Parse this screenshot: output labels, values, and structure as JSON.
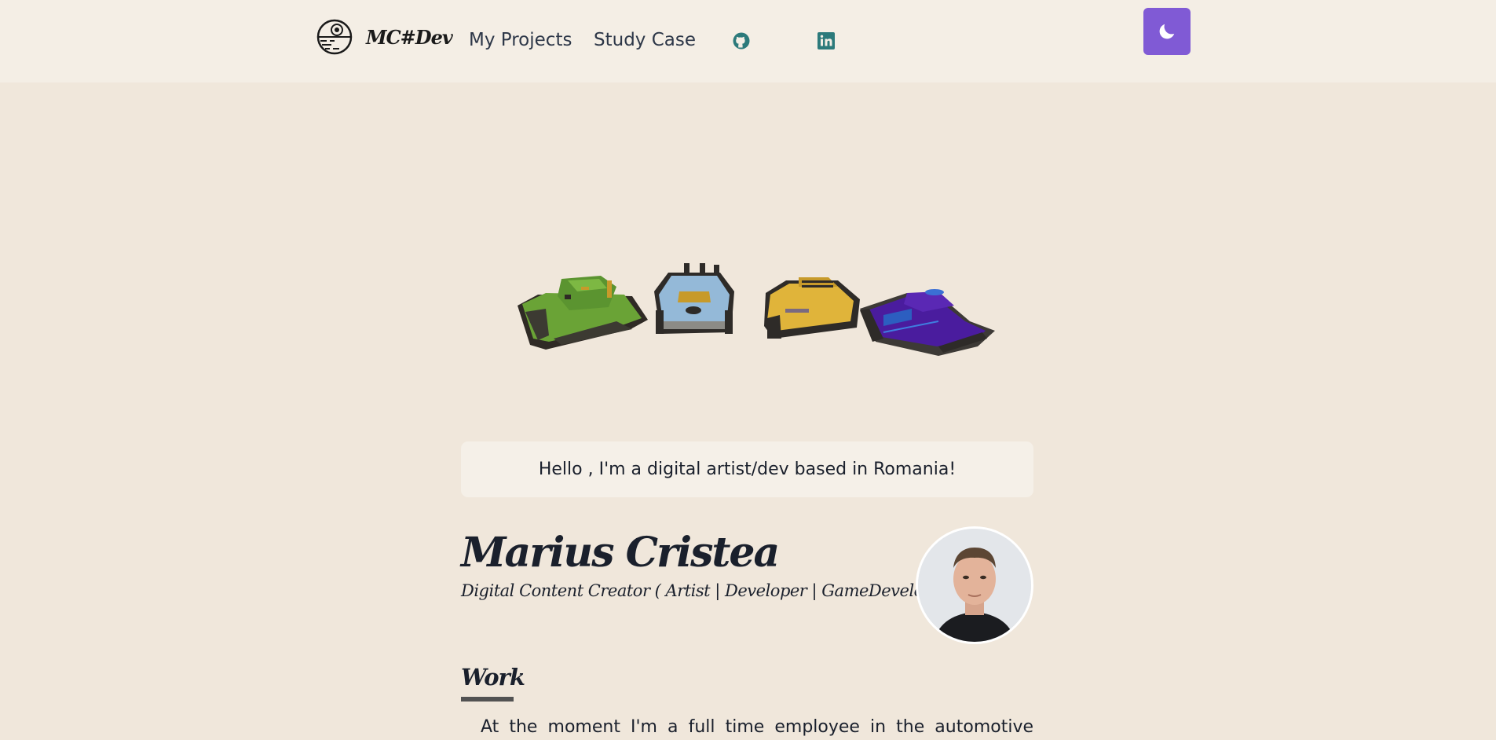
{
  "navbar": {
    "logo_text": "MC#Dev",
    "logo_icon": "death-star-icon",
    "links": [
      {
        "label": "My Projects"
      },
      {
        "label": "Study Case"
      }
    ],
    "github_icon": "github-icon",
    "linkedin_icon": "linkedin-icon",
    "theme_toggle_icon": "moon-icon",
    "colors": {
      "accent": "#805ad5",
      "icon": "#2c7a7b",
      "background": "#f4eee5"
    }
  },
  "hero": {
    "image": "low-poly-tanks"
  },
  "intro": {
    "text": "Hello , I'm a digital artist/dev based in Romania!"
  },
  "profile": {
    "name": "Marius Cristea",
    "role": "Digital Content Creator ( Artist | Developer | GameDeveloper)"
  },
  "work": {
    "heading": "Work",
    "text": "At the moment I'm a full time employee in the automotive"
  },
  "colors": {
    "page_background": "#f0e7db",
    "text": "#1a202c"
  }
}
